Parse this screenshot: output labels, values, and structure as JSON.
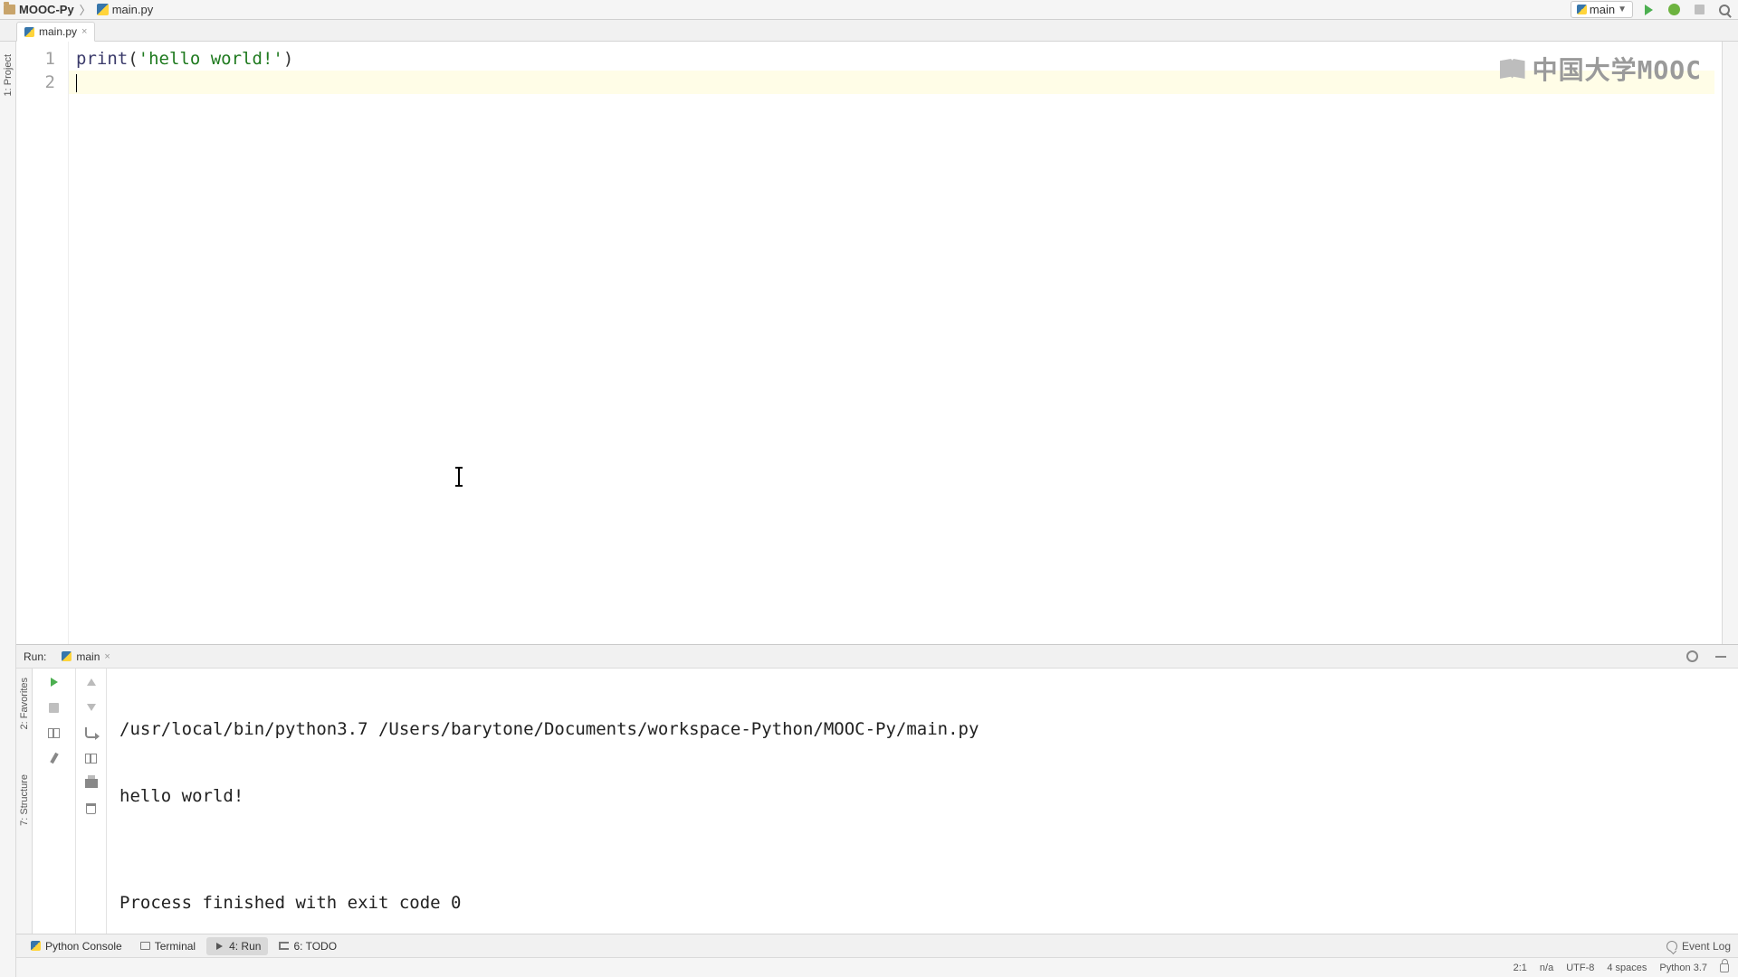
{
  "breadcrumb": {
    "project": "MOOC-Py",
    "file": "main.py"
  },
  "tabs": {
    "active": "main.py"
  },
  "run_config": {
    "name": "main"
  },
  "left_tool_tabs": {
    "project": "1: Project",
    "favorites": "2: Favorites",
    "structure": "7: Structure"
  },
  "code": {
    "lines": [
      "1",
      "2"
    ],
    "l1_kw": "print",
    "l1_open": "(",
    "l1_q1": "'",
    "l1_str": "hello world!",
    "l1_q2": "'",
    "l1_close": ")"
  },
  "watermark": "中国大学MOOC",
  "run_panel": {
    "title": "Run:",
    "config": "main",
    "output_cmd": "/usr/local/bin/python3.7 /Users/barytone/Documents/workspace-Python/MOOC-Py/main.py",
    "output_line": "hello world!",
    "blank": "",
    "finished": "Process finished with exit code 0"
  },
  "bottom_tabs": {
    "python_console": "Python Console",
    "terminal": "Terminal",
    "run": "4: Run",
    "todo": "6: TODO",
    "event_log": "Event Log"
  },
  "status": {
    "pos": "2:1",
    "na": "n/a",
    "enc": "UTF-8",
    "indent": "4 spaces",
    "interp": "Python 3.7"
  }
}
